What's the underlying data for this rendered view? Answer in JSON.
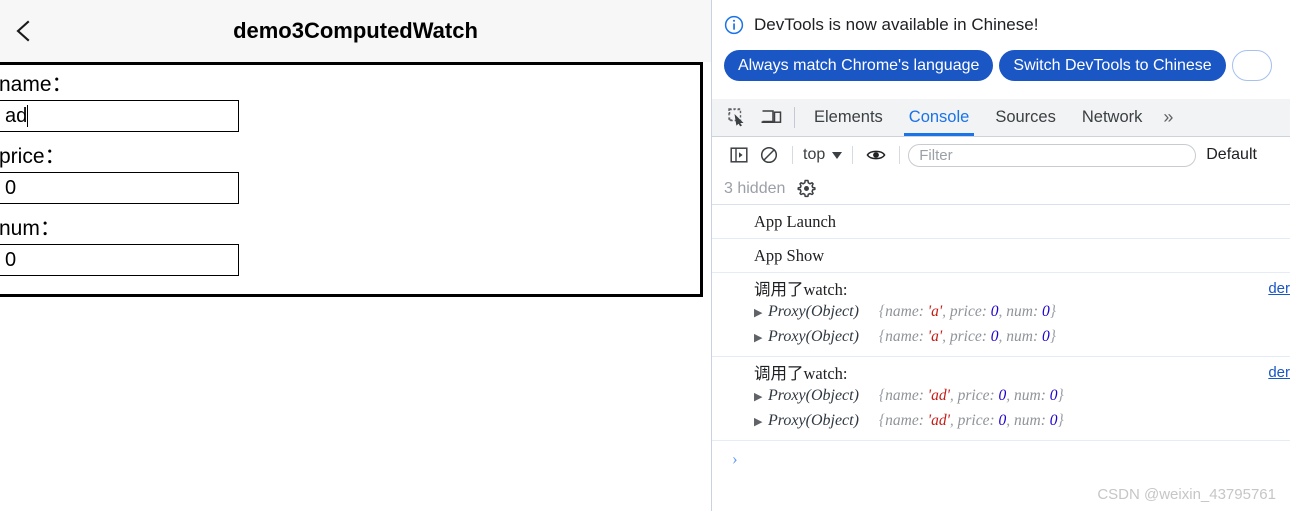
{
  "simulator": {
    "back_icon": "chevron-left-icon",
    "title": "demo3ComputedWatch",
    "form": {
      "fields": [
        {
          "label": "name：",
          "value": "ad",
          "focused": true
        },
        {
          "label": "price：",
          "value": "0",
          "focused": false
        },
        {
          "label": "num：",
          "value": "0",
          "focused": false
        }
      ]
    }
  },
  "devtools": {
    "notification": {
      "icon": "info-circle-icon",
      "message": "DevTools is now available in Chinese!",
      "buttons": [
        {
          "label": "Always match Chrome's language",
          "style": "primary"
        },
        {
          "label": "Switch DevTools to Chinese",
          "style": "primary"
        },
        {
          "label": "",
          "style": "outline"
        }
      ]
    },
    "toolbar": {
      "inspect_icon": "inspect-element-icon",
      "device_icon": "device-toolbar-icon",
      "tabs": [
        {
          "label": "Elements",
          "active": false
        },
        {
          "label": "Console",
          "active": true
        },
        {
          "label": "Sources",
          "active": false
        },
        {
          "label": "Network",
          "active": false
        }
      ],
      "more_tabs": "»"
    },
    "console_toolbar": {
      "sidebar_icon": "console-sidebar-icon",
      "clear_icon": "clear-console-icon",
      "context": "top",
      "eye_icon": "live-expression-icon",
      "filter_placeholder": "Filter",
      "filter_value": "",
      "levels_label": "Default"
    },
    "hidden_bar": {
      "hidden_count_label": "3 hidden",
      "settings_icon": "gear-icon"
    },
    "console_logs": [
      {
        "type": "plain",
        "text": "App Launch",
        "source": ""
      },
      {
        "type": "plain",
        "text": "App Show",
        "source": ""
      },
      {
        "type": "watch",
        "title": "调用了watch:",
        "source": "der",
        "objects": [
          {
            "disclosure": "▶",
            "name": "Proxy(Object)",
            "preview_open": "{",
            "entries": [
              {
                "key": "name:",
                "value": "'a'",
                "kind": "string"
              },
              {
                "key": "price:",
                "value": "0",
                "kind": "number"
              },
              {
                "key": "num:",
                "value": "0",
                "kind": "number"
              }
            ],
            "preview_close": "}"
          },
          {
            "disclosure": "▶",
            "name": "Proxy(Object)",
            "preview_open": "{",
            "entries": [
              {
                "key": "name:",
                "value": "'a'",
                "kind": "string"
              },
              {
                "key": "price:",
                "value": "0",
                "kind": "number"
              },
              {
                "key": "num:",
                "value": "0",
                "kind": "number"
              }
            ],
            "preview_close": "}"
          }
        ]
      },
      {
        "type": "watch",
        "title": "调用了watch:",
        "source": "der",
        "objects": [
          {
            "disclosure": "▶",
            "name": "Proxy(Object)",
            "preview_open": "{",
            "entries": [
              {
                "key": "name:",
                "value": "'ad'",
                "kind": "string"
              },
              {
                "key": "price:",
                "value": "0",
                "kind": "number"
              },
              {
                "key": "num:",
                "value": "0",
                "kind": "number"
              }
            ],
            "preview_close": "}"
          },
          {
            "disclosure": "▶",
            "name": "Proxy(Object)",
            "preview_open": "{",
            "entries": [
              {
                "key": "name:",
                "value": "'ad'",
                "kind": "string"
              },
              {
                "key": "price:",
                "value": "0",
                "kind": "number"
              },
              {
                "key": "num:",
                "value": "0",
                "kind": "number"
              }
            ],
            "preview_close": "}"
          }
        ]
      }
    ],
    "prompt": {
      "arrow": "›"
    },
    "watermark": "CSDN @weixin_43795761"
  },
  "colors": {
    "accent_blue": "#1a73e8",
    "button_blue": "#1a56c4",
    "string_red": "#c41a16",
    "number_blue": "#1c00cf",
    "muted_grey": "#9aa0a6"
  }
}
